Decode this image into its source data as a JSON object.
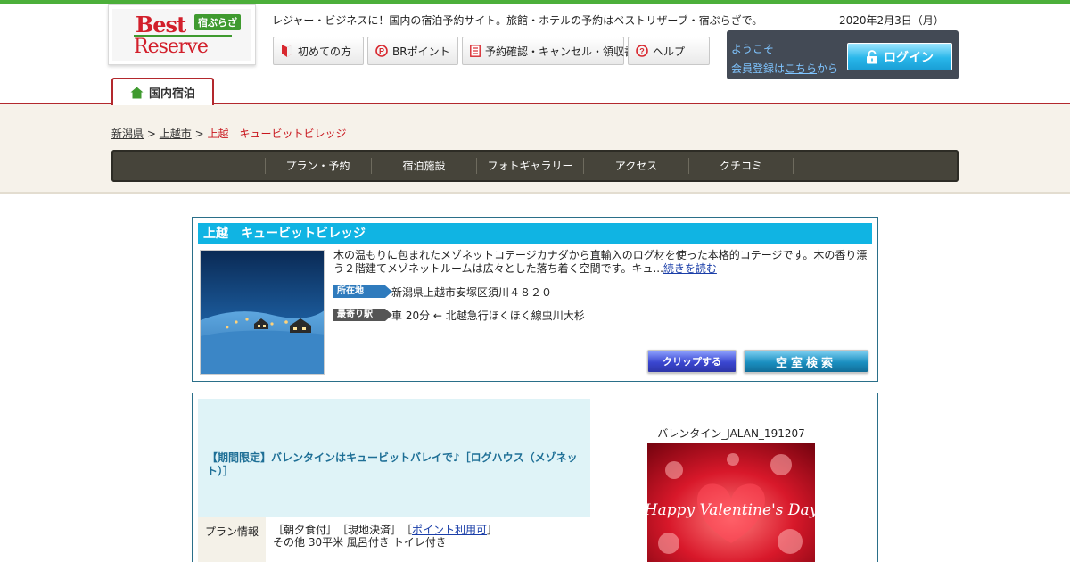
{
  "header": {
    "logo": {
      "line1": "Best",
      "line2": "Reserve",
      "badge": "宿ぷらざ"
    },
    "tagline": "レジャー・ビジネスに！国内の宿泊予約サイト。旅館・ホテルの予約はベストリザーブ・宿ぷらざで。",
    "date": "2020年2月3日（月）",
    "buttons": [
      {
        "label": "初めての方",
        "icon": "beginner-icon"
      },
      {
        "label": "BRポイント",
        "icon": "points-icon"
      },
      {
        "label": "予約確認・キャンセル・領収書",
        "icon": "document-icon"
      },
      {
        "label": "ヘルプ",
        "icon": "help-icon"
      }
    ],
    "login": {
      "welcome": "ようこそ",
      "register_prefix": "会員登録は",
      "register_link": "こちら",
      "register_suffix": "から",
      "button": "ログイン"
    }
  },
  "tab": {
    "label": "国内宿泊",
    "icon": "home-icon"
  },
  "breadcrumb": [
    {
      "label": "新潟県",
      "link": true
    },
    {
      "label": "上越市",
      "link": true
    },
    {
      "label": "上越　キュービットビレッジ",
      "link": false
    }
  ],
  "breadcrumb_sep": ">",
  "nav": [
    "プラン・予約",
    "宿泊施設",
    "フォトギャラリー",
    "アクセス",
    "クチコミ"
  ],
  "hotel": {
    "title": "上越　キュービットビレッジ",
    "description": "木の温もりに包まれたメゾネットコテージカナダから直輸入のログ材を使った本格的コテージです。木の香り漂う２階建てメゾネットルームは広々とした落ち着く空間です。キュ...",
    "read_more": "続きを読む",
    "location_label": "所在地",
    "location": "新潟県上越市安塚区須川４８２０",
    "station_label": "最寄り駅",
    "station": "車 20分 ← 北越急行ほくほく線虫川大杉",
    "clip_button": "クリップする",
    "search_button": "空室検索"
  },
  "plan": {
    "title": "【期間限定】バレンタインはキュービットバレイで♪［ログハウス（メゾネット）］",
    "info_label": "プラン情報",
    "info_line1_a": "［朝夕食付］　［現地決済］　［",
    "info_line1_link": "ポイント利用可",
    "info_line1_b": "］",
    "info_line2": "その他 30平米 風呂付き トイレ付き",
    "image_title": "バレンタイン_JALAN_191207",
    "image_text": "Happy Valentine's Day"
  },
  "colors": {
    "top_bar": "#4caf3a",
    "accent_red": "#b3282d",
    "title_blue": "#10b4e3",
    "nav_bg": "#46443a",
    "band_bg": "#f6f2ea"
  }
}
